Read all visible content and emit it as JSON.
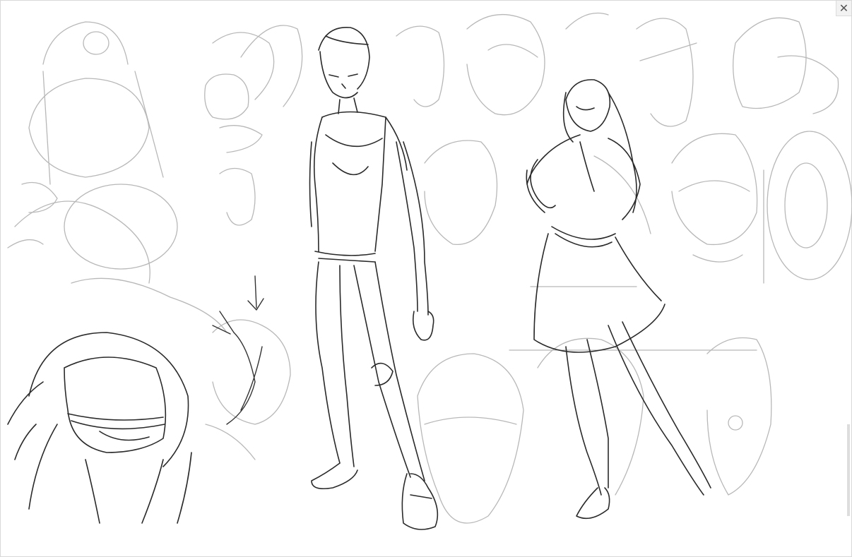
{
  "viewer": {
    "close_label": "✕"
  },
  "colors": {
    "background": "#ffffff",
    "sketch_dark": "#2a2a2a",
    "sketch_light": "#b8b8b8"
  }
}
